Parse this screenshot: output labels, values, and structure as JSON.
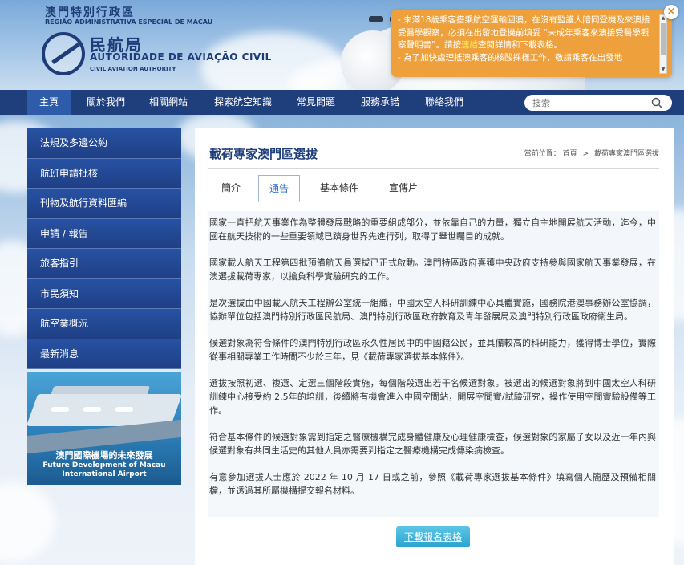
{
  "header": {
    "gov_zh": "澳門特別行政區",
    "gov_pt": "REGIÃO ADMINISTRATIVA ESPECIAL DE MACAU",
    "caa_zh": "民航局",
    "caa_pt": "AUTORIDADE DE AVIAÇÃO CIVIL",
    "caa_en": "CIVIL AVIATION AUTHORITY"
  },
  "notice": {
    "item1_a": "- 未滿18歲乘客搭乘航空運輸回澳，在沒有監護人陪同登機及來澳接受醫學觀察，必須在出發地登機前填妥 “未成年乘客來澳接受醫學觀察聲明書”。請按",
    "item1_link": "連結",
    "item1_b": "查閱詳情和下載表格。",
    "item2": "- 為了加快處理抵澳乘客的核酸採樣工作，敬請乘客在出發地",
    "close_label": "×"
  },
  "nav": {
    "items": [
      "主頁",
      "關於我們",
      "相關網站",
      "探索航空知識",
      "常見問題",
      "服務承諾",
      "聯絡我們"
    ],
    "search_placeholder": "搜索"
  },
  "sidebar": {
    "items": [
      "法規及多邊公約",
      "航班申請批核",
      "刊物及航行資料匯編",
      "申請 / 報告",
      "旅客指引",
      "市民須知",
      "航空業概況",
      "最新消息"
    ],
    "banner_zh": "澳門國際機場的未來發展",
    "banner_en1": "Future Development of Macau",
    "banner_en2": "International Airport"
  },
  "content": {
    "title": "載荷專家澳門區選拔",
    "breadcrumb_label": "當前位置：",
    "breadcrumb_home": "首頁",
    "breadcrumb_sep": ">",
    "breadcrumb_current": "載荷專家澳門區選拔",
    "tabs": [
      "簡介",
      "通告",
      "基本條件",
      "宣傳片"
    ],
    "active_tab": "通告",
    "paragraphs": [
      "國家一直把航天事業作為整體發展戰略的重要組成部分，並依靠自己的力量，獨立自主地開展航天活動，迄今，中國在航天技術的一些重要領域已躋身世界先進行列，取得了舉世矚目的成就。",
      "國家載人航天工程第四批預備航天員選拔已正式啟動。澳門特區政府喜獲中央政府支持參與國家航天事業發展，在澳選拔載荷專家，以擔負科學實驗研究的工作。",
      "是次選拔由中國載人航天工程辦公室統一組織，中國太空人科研訓練中心具體實施，國務院港澳事務辦公室協調，協辦單位包括澳門特別行政區民航局、澳門特別行政區政府教育及青年發展局及澳門特別行政區政府衛生局。",
      "候選對象為符合條件的澳門特別行政區永久性居民中的中國籍公民，並具備較高的科研能力，獲得博士學位，實際從事相關專業工作時間不少於三年，見《載荷專家選拔基本條件》。",
      "選拔按照初選、複選、定選三個階段實施，每個階段選出若干名候選對象。被選出的候選對象將到中國太空人科研訓練中心接受約 2.5年的培訓，後續將有機會進入中國空間站，開展空間實/試驗研究，操作使用空間實驗設備等工作。",
      "符合基本條件的候選對象需到指定之醫療機構完成身體健康及心理健康檢查，候選對象的家屬子女以及近一年內與候選對象有共同生活史的其他人員亦需要到指定之醫療機構完成傳染病檢查。",
      "有意參加選拔人士應於 2022 年 10 月 17 日或之前，參照《載荷專家選拔基本條件》填寫個人簡歷及預備相關檔，並透過其所屬機構提交報名材料。"
    ],
    "download_label": "下載報名表格"
  },
  "colors": {
    "nav_bg": "#1f3e7c",
    "nav_active": "#2f5ca8",
    "notice_bg": "#eea03c",
    "title": "#1f3e7c",
    "tab_active": "#2a6fc4",
    "button": "#2aa3cf"
  },
  "icons": {
    "search": "magnifier",
    "close": "x-mark",
    "logo": "caa-emblem"
  }
}
